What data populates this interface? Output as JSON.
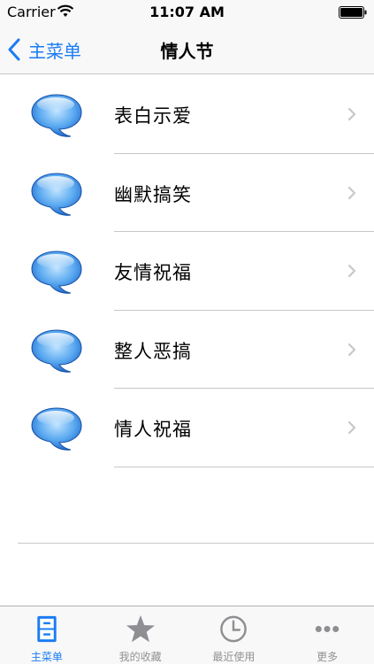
{
  "status_bar": {
    "carrier": "Carrier",
    "time": "11:07 AM"
  },
  "nav": {
    "back_label": "主菜单",
    "title": "情人节"
  },
  "list": {
    "items": [
      {
        "label": "表白示爱"
      },
      {
        "label": "幽默搞笑"
      },
      {
        "label": "友情祝福"
      },
      {
        "label": "整人恶搞"
      },
      {
        "label": "情人祝福"
      }
    ]
  },
  "tab_bar": {
    "tabs": [
      {
        "label": "主菜单",
        "icon": "cabinet-icon",
        "active": true
      },
      {
        "label": "我的收藏",
        "icon": "star-icon",
        "active": false
      },
      {
        "label": "最近使用",
        "icon": "clock-icon",
        "active": false
      },
      {
        "label": "更多",
        "icon": "more-dots-icon",
        "active": false
      }
    ]
  },
  "colors": {
    "accent": "#1a7cf4",
    "inactive_tab": "#929292",
    "separator": "#c8c7cc",
    "bar_background": "#f8f8f8"
  }
}
